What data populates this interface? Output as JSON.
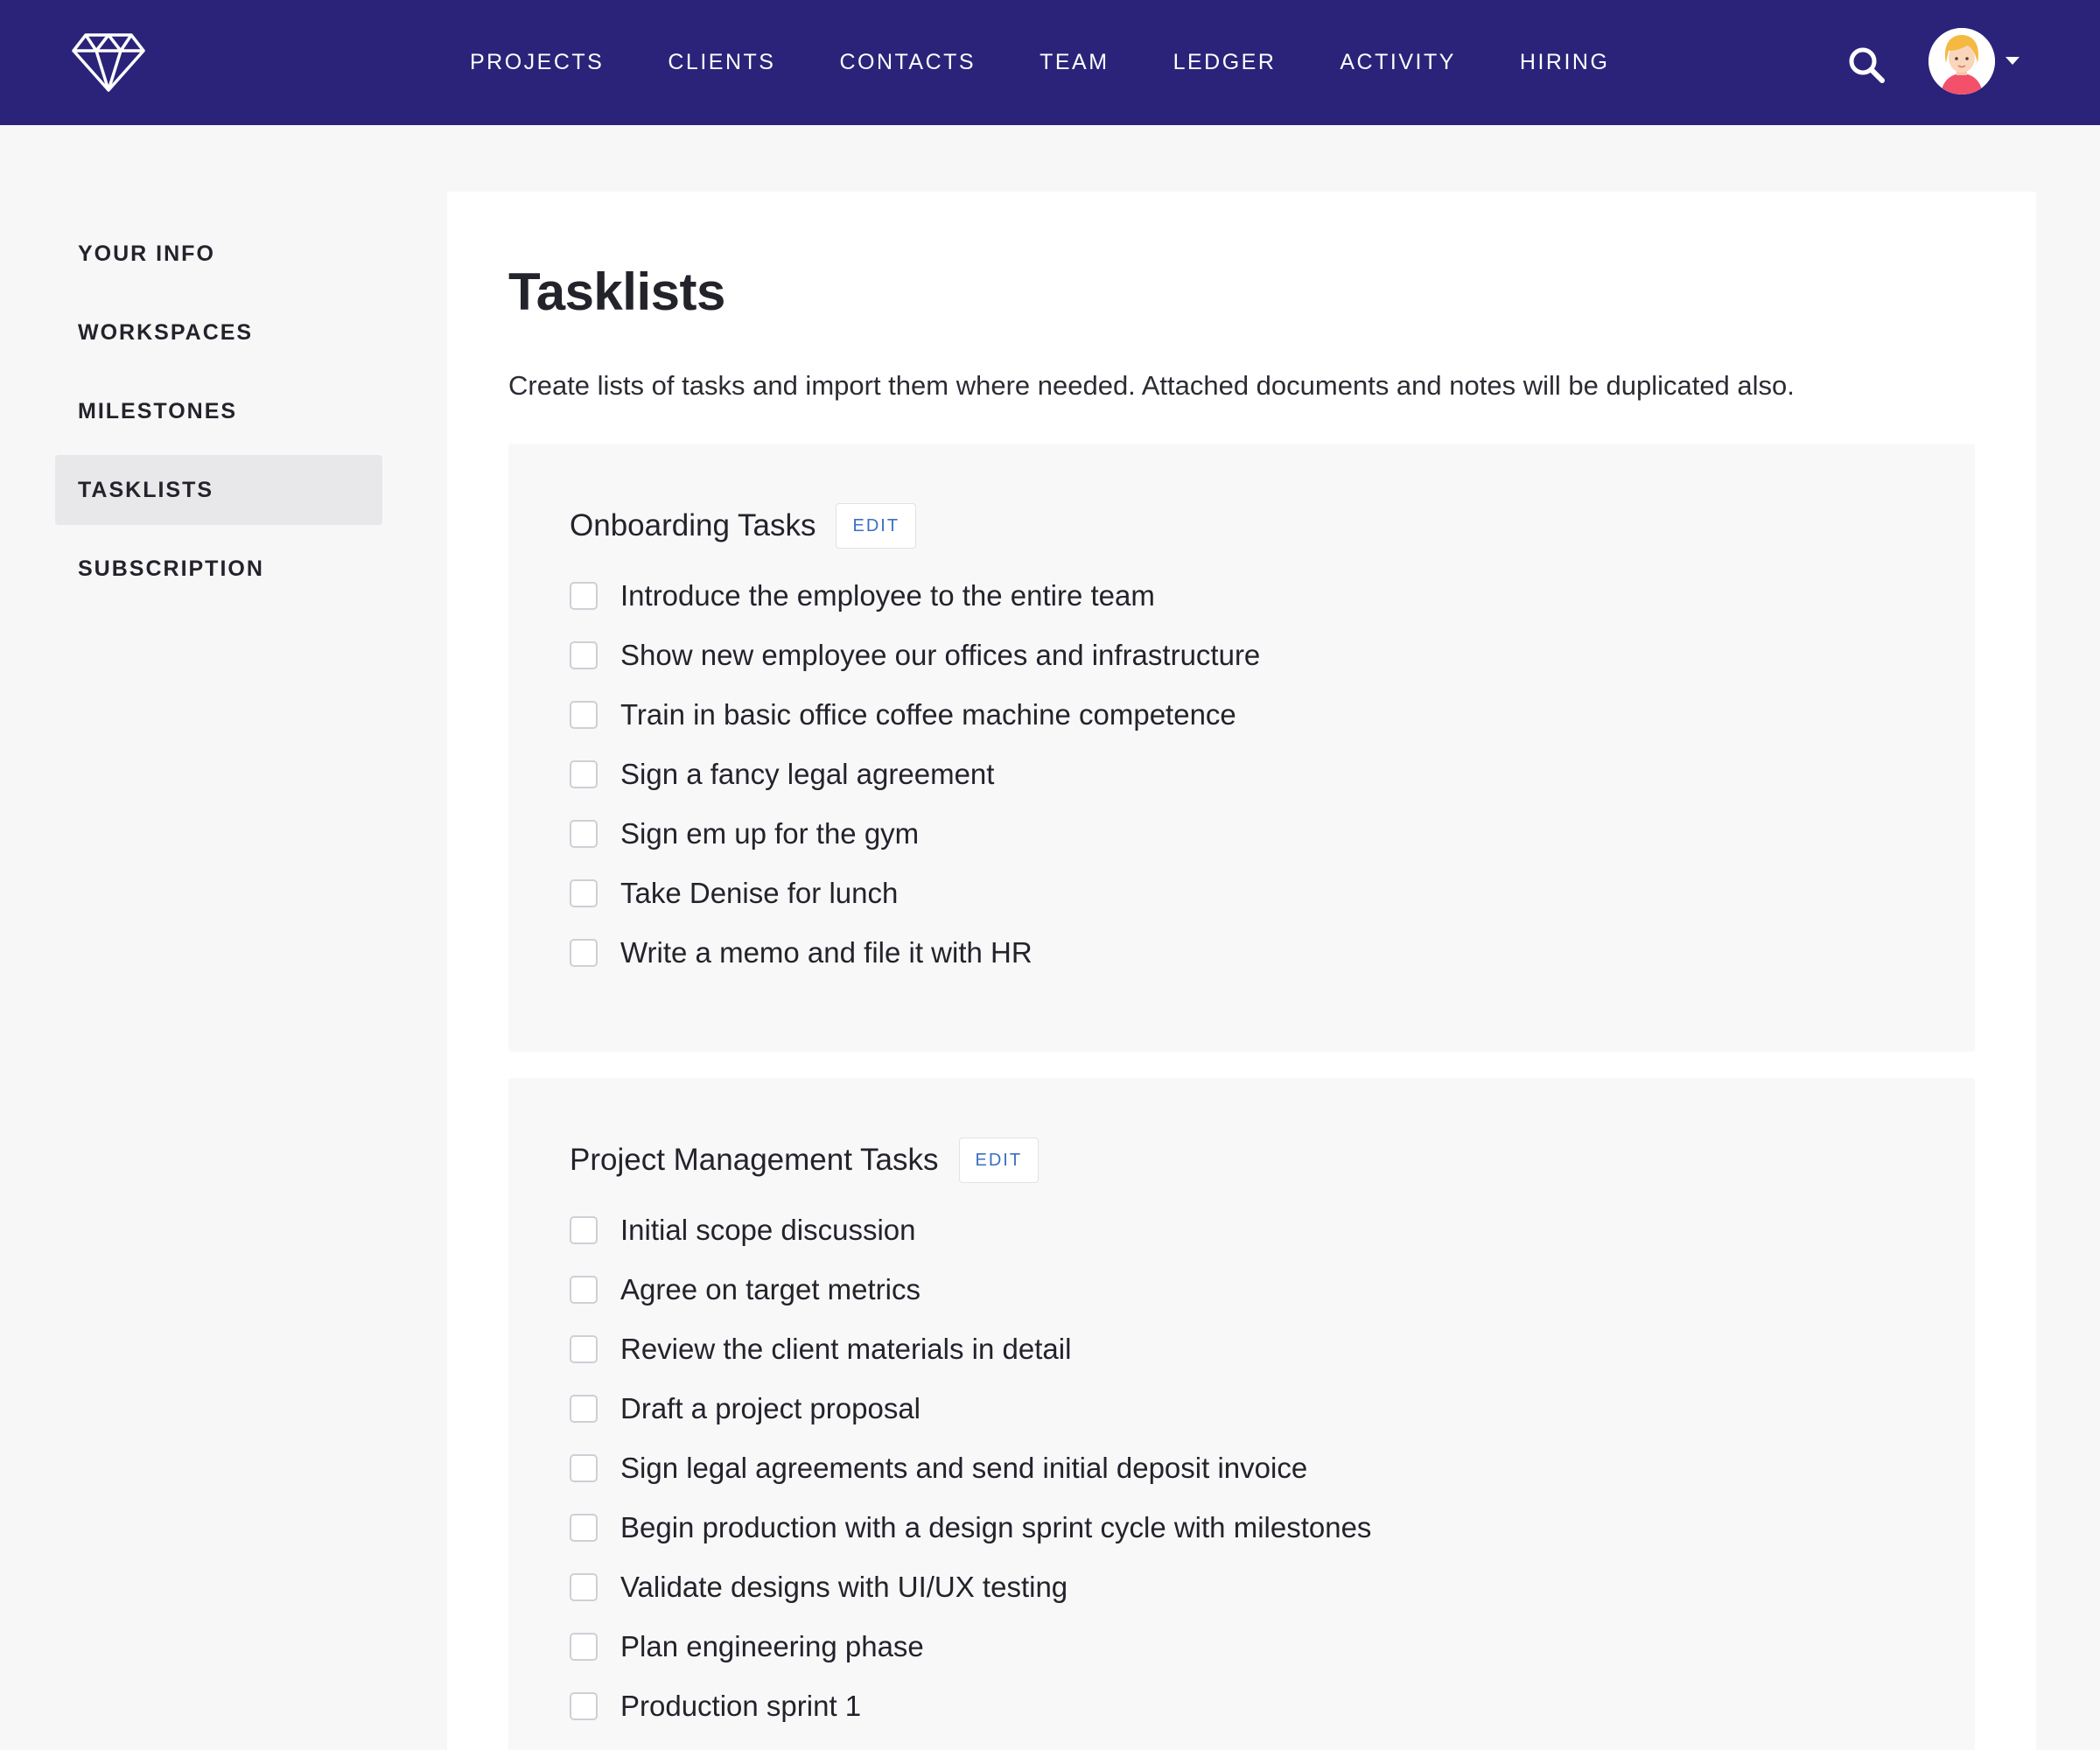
{
  "header": {
    "logo_icon": "diamond-icon",
    "nav": [
      "PROJECTS",
      "CLIENTS",
      "CONTACTS",
      "TEAM",
      "LEDGER",
      "ACTIVITY",
      "HIRING"
    ],
    "search_icon": "search-icon",
    "avatar_icon": "user-avatar",
    "menu_icon": "caret-down-icon"
  },
  "sidebar": {
    "items": [
      {
        "label": "YOUR INFO",
        "active": false
      },
      {
        "label": "WORKSPACES",
        "active": false
      },
      {
        "label": "MILESTONES",
        "active": false
      },
      {
        "label": "TASKLISTS",
        "active": true
      },
      {
        "label": "SUBSCRIPTION",
        "active": false
      }
    ]
  },
  "main": {
    "title": "Tasklists",
    "description": "Create lists of tasks and import them where needed. Attached documents and notes will be duplicated also.",
    "tasklists": [
      {
        "title": "Onboarding Tasks",
        "edit_label": "EDIT",
        "tasks": [
          {
            "label": "Introduce the employee to the entire team",
            "checked": false
          },
          {
            "label": "Show new employee our offices and infrastructure",
            "checked": false
          },
          {
            "label": "Train in basic office coffee machine competence",
            "checked": false
          },
          {
            "label": "Sign a fancy legal agreement",
            "checked": false
          },
          {
            "label": "Sign em up for the gym",
            "checked": false
          },
          {
            "label": "Take Denise for lunch",
            "checked": false
          },
          {
            "label": "Write a memo and file it with HR",
            "checked": false
          }
        ]
      },
      {
        "title": "Project Management Tasks",
        "edit_label": "EDIT",
        "tasks": [
          {
            "label": "Initial scope discussion",
            "checked": false
          },
          {
            "label": "Agree on target metrics",
            "checked": false
          },
          {
            "label": "Review the client materials in detail",
            "checked": false
          },
          {
            "label": "Draft a project proposal",
            "checked": false
          },
          {
            "label": "Sign legal agreements and send initial deposit invoice",
            "checked": false
          },
          {
            "label": "Begin production with a design sprint cycle with milestones",
            "checked": false
          },
          {
            "label": "Validate designs with UI/UX testing",
            "checked": false
          },
          {
            "label": "Plan engineering phase",
            "checked": false
          },
          {
            "label": "Production sprint 1",
            "checked": false
          }
        ]
      }
    ]
  },
  "colors": {
    "header_bg": "#2a2379",
    "page_bg": "#f7f7f8",
    "card_bg": "#f8f8f9",
    "active_nav_bg": "#e8e8eb",
    "edit_link": "#3b6fc2"
  }
}
